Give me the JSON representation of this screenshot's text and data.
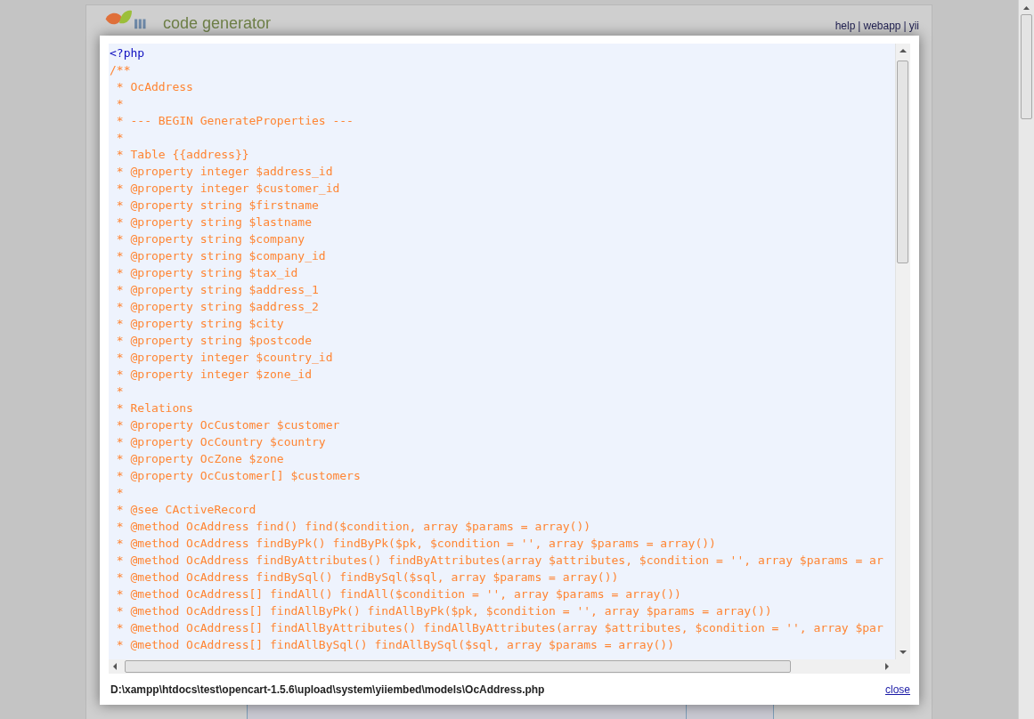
{
  "header": {
    "logo_text": "code generator",
    "links": [
      "help",
      "webapp",
      "yii"
    ],
    "separator": "|"
  },
  "dialog": {
    "code_lines": [
      {
        "kind": "tag",
        "text": "<?php"
      },
      {
        "kind": "comment",
        "text": "/**"
      },
      {
        "kind": "comment",
        "text": " * OcAddress"
      },
      {
        "kind": "comment",
        "text": " *"
      },
      {
        "kind": "comment",
        "text": " * --- BEGIN GenerateProperties ---"
      },
      {
        "kind": "comment",
        "text": " *"
      },
      {
        "kind": "comment",
        "text": " * Table {{address}}"
      },
      {
        "kind": "comment",
        "text": " * @property integer $address_id"
      },
      {
        "kind": "comment",
        "text": " * @property integer $customer_id"
      },
      {
        "kind": "comment",
        "text": " * @property string $firstname"
      },
      {
        "kind": "comment",
        "text": " * @property string $lastname"
      },
      {
        "kind": "comment",
        "text": " * @property string $company"
      },
      {
        "kind": "comment",
        "text": " * @property string $company_id"
      },
      {
        "kind": "comment",
        "text": " * @property string $tax_id"
      },
      {
        "kind": "comment",
        "text": " * @property string $address_1"
      },
      {
        "kind": "comment",
        "text": " * @property string $address_2"
      },
      {
        "kind": "comment",
        "text": " * @property string $city"
      },
      {
        "kind": "comment",
        "text": " * @property string $postcode"
      },
      {
        "kind": "comment",
        "text": " * @property integer $country_id"
      },
      {
        "kind": "comment",
        "text": " * @property integer $zone_id"
      },
      {
        "kind": "comment",
        "text": " *"
      },
      {
        "kind": "comment",
        "text": " * Relations"
      },
      {
        "kind": "comment",
        "text": " * @property OcCustomer $customer"
      },
      {
        "kind": "comment",
        "text": " * @property OcCountry $country"
      },
      {
        "kind": "comment",
        "text": " * @property OcZone $zone"
      },
      {
        "kind": "comment",
        "text": " * @property OcCustomer[] $customers"
      },
      {
        "kind": "comment",
        "text": " *"
      },
      {
        "kind": "comment",
        "text": " * @see CActiveRecord"
      },
      {
        "kind": "comment",
        "text": " * @method OcAddress find() find($condition, array $params = array())"
      },
      {
        "kind": "comment",
        "text": " * @method OcAddress findByPk() findByPk($pk, $condition = '', array $params = array())"
      },
      {
        "kind": "comment",
        "text": " * @method OcAddress findByAttributes() findByAttributes(array $attributes, $condition = '', array $params = ar"
      },
      {
        "kind": "comment",
        "text": " * @method OcAddress findBySql() findBySql($sql, array $params = array())"
      },
      {
        "kind": "comment",
        "text": " * @method OcAddress[] findAll() findAll($condition = '', array $params = array())"
      },
      {
        "kind": "comment",
        "text": " * @method OcAddress[] findAllByPk() findAllByPk($pk, $condition = '', array $params = array())"
      },
      {
        "kind": "comment",
        "text": " * @method OcAddress[] findAllByAttributes() findAllByAttributes(array $attributes, $condition = '', array $par"
      },
      {
        "kind": "comment",
        "text": " * @method OcAddress[] findAllBySql() findAllBySql($sql, array $params = array())"
      }
    ],
    "file_path": "D:\\xampp\\htdocs\\test\\opencart-1.5.6\\upload\\system\\yiiembed\\models\\OcAddress.php",
    "close_label": "close"
  }
}
